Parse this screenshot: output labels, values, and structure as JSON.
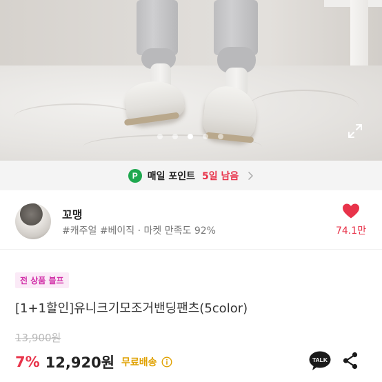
{
  "hero": {
    "slide_count": 5,
    "active_slide": 3,
    "expand_icon": "expand-icon"
  },
  "points_banner": {
    "badge": "P",
    "label": "매일 포인트",
    "remaining": "5일 남음",
    "chevron_icon": "chevron-right-icon",
    "badge_color": "#1fa84f"
  },
  "seller": {
    "name": "꼬맹",
    "meta": "#캐주얼 #베이직 · 마켓 만족도 92%",
    "likes": "74.1만",
    "heart_icon": "heart-icon"
  },
  "product": {
    "promo_badge": "전 상품 블프",
    "title": "[1+1할인]유니크기모조거밴딩팬츠(5color)",
    "original_price": "13,900원",
    "discount": "7%",
    "price": "12,920원",
    "shipping": "무료배송",
    "info_icon": "info-icon",
    "talk_label": "TALK",
    "share_icon": "share-icon"
  },
  "colors": {
    "accent_red": "#e8334a",
    "shipping_yellow": "#e0a100",
    "promo_pink": "#d12ea7",
    "promo_bg": "#fbeaf7"
  }
}
